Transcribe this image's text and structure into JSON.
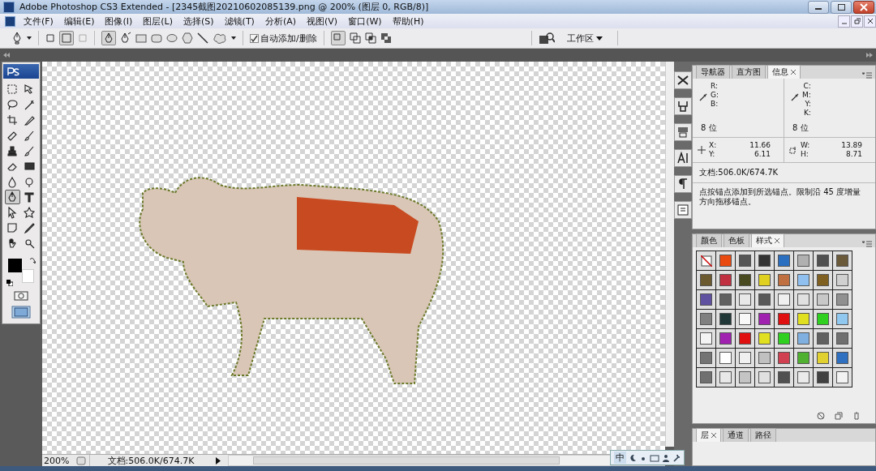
{
  "window": {
    "title": "Adobe Photoshop CS3 Extended - [2345截图20210602085139.png @ 200% (图层 0, RGB/8)]"
  },
  "menu": [
    "文件(F)",
    "编辑(E)",
    "图像(I)",
    "图层(L)",
    "选择(S)",
    "滤镜(T)",
    "分析(A)",
    "视图(V)",
    "窗口(W)",
    "帮助(H)"
  ],
  "options_bar": {
    "auto_add_delete": {
      "label": "自动添加/删除",
      "checked": true
    },
    "workspace": {
      "label": "工作区"
    }
  },
  "tools": [
    {
      "kind": "marquee",
      "selected": false
    },
    {
      "kind": "move",
      "selected": false
    },
    {
      "kind": "lasso",
      "selected": false
    },
    {
      "kind": "wand",
      "selected": false
    },
    {
      "kind": "crop",
      "selected": false
    },
    {
      "kind": "slice",
      "selected": false
    },
    {
      "kind": "bandage",
      "selected": false
    },
    {
      "kind": "brush",
      "selected": false
    },
    {
      "kind": "stamp",
      "selected": false
    },
    {
      "kind": "brush",
      "selected": false
    },
    {
      "kind": "eraser",
      "selected": false
    },
    {
      "kind": "gradient",
      "selected": false
    },
    {
      "kind": "drop",
      "selected": false
    },
    {
      "kind": "dodge",
      "selected": false
    },
    {
      "kind": "pen",
      "selected": true
    },
    {
      "kind": "type",
      "selected": false
    },
    {
      "kind": "arrow",
      "selected": false
    },
    {
      "kind": "shape",
      "selected": false
    },
    {
      "kind": "note",
      "selected": false
    },
    {
      "kind": "eyedropper",
      "selected": false
    },
    {
      "kind": "hand",
      "selected": false
    },
    {
      "kind": "zoom",
      "selected": false
    }
  ],
  "info_panel": {
    "tabs": [
      {
        "label": "导航器",
        "selected": false
      },
      {
        "label": "直方图",
        "selected": false
      },
      {
        "label": "信息",
        "selected": true
      }
    ],
    "rgb_labels": [
      "R:",
      "G:",
      "B:"
    ],
    "cmyk_labels": [
      "C:",
      "M:",
      "Y:",
      "K:"
    ],
    "rgb_depth": "8 位",
    "cmyk_depth": "8 位",
    "position": [
      {
        "label": "X:",
        "value": "11.66"
      },
      {
        "label": "Y:",
        "value": "6.11"
      }
    ],
    "size": [
      {
        "label": "W:",
        "value": "13.89"
      },
      {
        "label": "H:",
        "value": "8.71"
      }
    ],
    "document": "文档:506.0K/674.7K",
    "hint": "点按锚点添加到所选锚点。限制沿 45 度增量方向拖移锚点。"
  },
  "styles_panel": {
    "tabs": [
      {
        "label": "颜色",
        "selected": false
      },
      {
        "label": "色板",
        "selected": false
      },
      {
        "label": "样式",
        "selected": true
      }
    ],
    "swatches": [
      {
        "kind": "none"
      },
      {
        "kind": "fill",
        "color": "#e84a10"
      },
      {
        "kind": "fill",
        "color": "#555555"
      },
      {
        "kind": "fill",
        "color": "#333333"
      },
      {
        "kind": "fill",
        "color": "#2a6fc0"
      },
      {
        "kind": "fill",
        "color": "#b0b0b0"
      },
      {
        "kind": "fill",
        "color": "#505050"
      },
      {
        "kind": "fill",
        "color": "#6b5a3a"
      },
      {
        "kind": "fill",
        "color": "#6b5a30"
      },
      {
        "kind": "fill",
        "color": "#c03040"
      },
      {
        "kind": "fill",
        "color": "#4a4a20"
      },
      {
        "kind": "fill",
        "color": "#e0d020"
      },
      {
        "kind": "fill",
        "color": "#c07040"
      },
      {
        "kind": "fill",
        "color": "#90c0f0"
      },
      {
        "kind": "fill",
        "color": "#806020"
      },
      {
        "kind": "fill",
        "color": "#d0d0d0"
      },
      {
        "kind": "fill",
        "color": "#6050a0"
      },
      {
        "kind": "fill",
        "color": "#606060"
      },
      {
        "kind": "fill",
        "color": "#e8e8e8"
      },
      {
        "kind": "fill",
        "color": "#585858"
      },
      {
        "kind": "fill",
        "color": "#f0f0f0"
      },
      {
        "kind": "fill",
        "color": "#e0e0e0"
      },
      {
        "kind": "fill",
        "color": "#c8c8c8"
      },
      {
        "kind": "fill",
        "color": "#909090"
      },
      {
        "kind": "fill",
        "color": "#808080"
      },
      {
        "kind": "fill",
        "color": "#203838"
      },
      {
        "kind": "fill",
        "color": "#f8f8f8"
      },
      {
        "kind": "fill",
        "color": "#a020b0"
      },
      {
        "kind": "fill",
        "color": "#e01010"
      },
      {
        "kind": "fill",
        "color": "#e0e020"
      },
      {
        "kind": "fill",
        "color": "#30d020"
      },
      {
        "kind": "fill",
        "color": "#90c8f0"
      },
      {
        "kind": "fill",
        "color": "#f4f4f4"
      },
      {
        "kind": "fill",
        "color": "#a020b0"
      },
      {
        "kind": "fill",
        "color": "#e01010"
      },
      {
        "kind": "fill",
        "color": "#e0e020"
      },
      {
        "kind": "fill",
        "color": "#30d020"
      },
      {
        "kind": "fill",
        "color": "#80b0e0"
      },
      {
        "kind": "fill",
        "color": "#606060"
      },
      {
        "kind": "fill",
        "color": "#707070"
      },
      {
        "kind": "fill",
        "color": "#747474"
      },
      {
        "kind": "fill",
        "color": "#ffffff"
      },
      {
        "kind": "fill",
        "color": "#f0f0f0"
      },
      {
        "kind": "fill",
        "color": "#c0c0c0"
      },
      {
        "kind": "fill",
        "color": "#d04050"
      },
      {
        "kind": "fill",
        "color": "#50b030"
      },
      {
        "kind": "fill",
        "color": "#e0d030"
      },
      {
        "kind": "fill",
        "color": "#3070c0"
      },
      {
        "kind": "fill",
        "color": "#707070"
      },
      {
        "kind": "fill",
        "color": "#e8e8e8"
      },
      {
        "kind": "fill",
        "color": "#c4c4c4"
      },
      {
        "kind": "fill",
        "color": "#e0e0e0"
      },
      {
        "kind": "fill",
        "color": "#505050"
      },
      {
        "kind": "fill",
        "color": "#eaeaea"
      },
      {
        "kind": "fill",
        "color": "#404040"
      },
      {
        "kind": "fill",
        "color": "#f2f2f2"
      }
    ]
  },
  "layers_panel": {
    "tabs": [
      {
        "label": "层",
        "selected": true
      },
      {
        "label": "通道",
        "selected": false
      },
      {
        "label": "路径",
        "selected": false
      }
    ]
  },
  "status_bar": {
    "zoom": "200%",
    "document": "文档:506.0K/674.7K"
  },
  "ime_bar": {
    "label": "中"
  }
}
